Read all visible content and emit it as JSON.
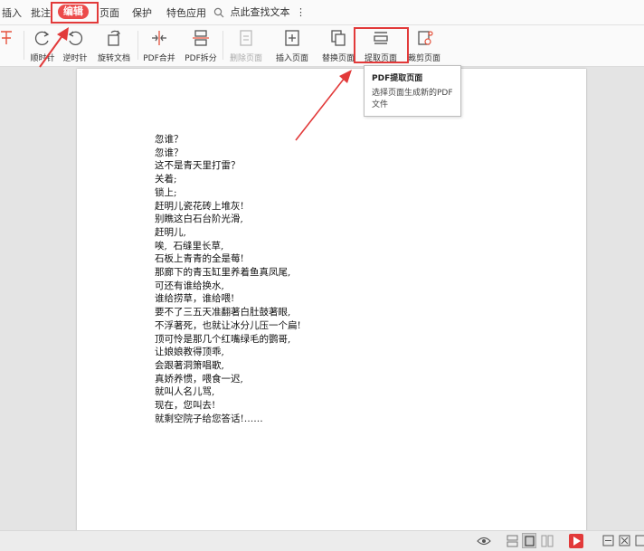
{
  "menubar": {
    "items": [
      "插入",
      "批注",
      "编辑",
      "页面",
      "保护",
      "特色应用"
    ],
    "active_index": 2,
    "search_label": "点此查找文本",
    "accent_color": "#ec4b4b"
  },
  "ribbon": {
    "tools": [
      {
        "label": "",
        "icon": "clip-icon",
        "disabled": false
      },
      {
        "label": "顺时针",
        "icon": "rotate-clockwise-icon",
        "disabled": false
      },
      {
        "label": "逆时针",
        "icon": "rotate-counterclockwise-icon",
        "disabled": false
      },
      {
        "label": "旋转文档",
        "icon": "rotate-document-icon",
        "disabled": false
      },
      {
        "label": "PDF合并",
        "icon": "pdf-merge-icon",
        "disabled": false
      },
      {
        "label": "PDF拆分",
        "icon": "pdf-split-icon",
        "disabled": false
      },
      {
        "label": "删除页面",
        "icon": "delete-page-icon",
        "disabled": true
      },
      {
        "label": "插入页面",
        "icon": "insert-page-icon",
        "disabled": false
      },
      {
        "label": "替换页面",
        "icon": "replace-page-icon",
        "disabled": false
      },
      {
        "label": "提取页面",
        "icon": "extract-page-icon",
        "disabled": false
      },
      {
        "label": "裁剪页面",
        "icon": "crop-page-icon",
        "disabled": false
      }
    ]
  },
  "tooltip": {
    "title": "PDF提取页面",
    "description": "选择页面生成新的PDF文件"
  },
  "document": {
    "lines": [
      "忽谁？",
      "忽谁？",
      "这不是青天里打雷？",
      "关着;",
      "锁上;",
      "赶明儿瓷花砖上堆灰!",
      "别瞧这白石台阶光滑,",
      "赶明儿,",
      "唉,  石缝里长草,",
      "石板上青青的全是莓!",
      "那廊下的青玉缸里养着鱼真凤尾,",
      "可还有谁给换水,",
      "谁给捞草，谁给喂!",
      "要不了三五天准翻著白肚鼓著眼,",
      "不浮著死，也就让冰分儿压一个扁!",
      "顶可怜是那几个红嘴绿毛的鹦哥,",
      "让娘娘教得顶乖,",
      "会跟著洞箫唱歌,",
      "真娇养惯，喂食一迟,",
      "就叫人名儿骂,",
      "现在，您叫去!",
      "就剩空院子给您答话!……"
    ]
  },
  "statusbar": {
    "icons": [
      "eye-icon",
      "single-page-view-icon",
      "continuous-view-icon",
      "two-page-view-icon",
      "play-icon",
      "fit-width-icon",
      "fit-page-icon",
      "more-icon"
    ]
  }
}
